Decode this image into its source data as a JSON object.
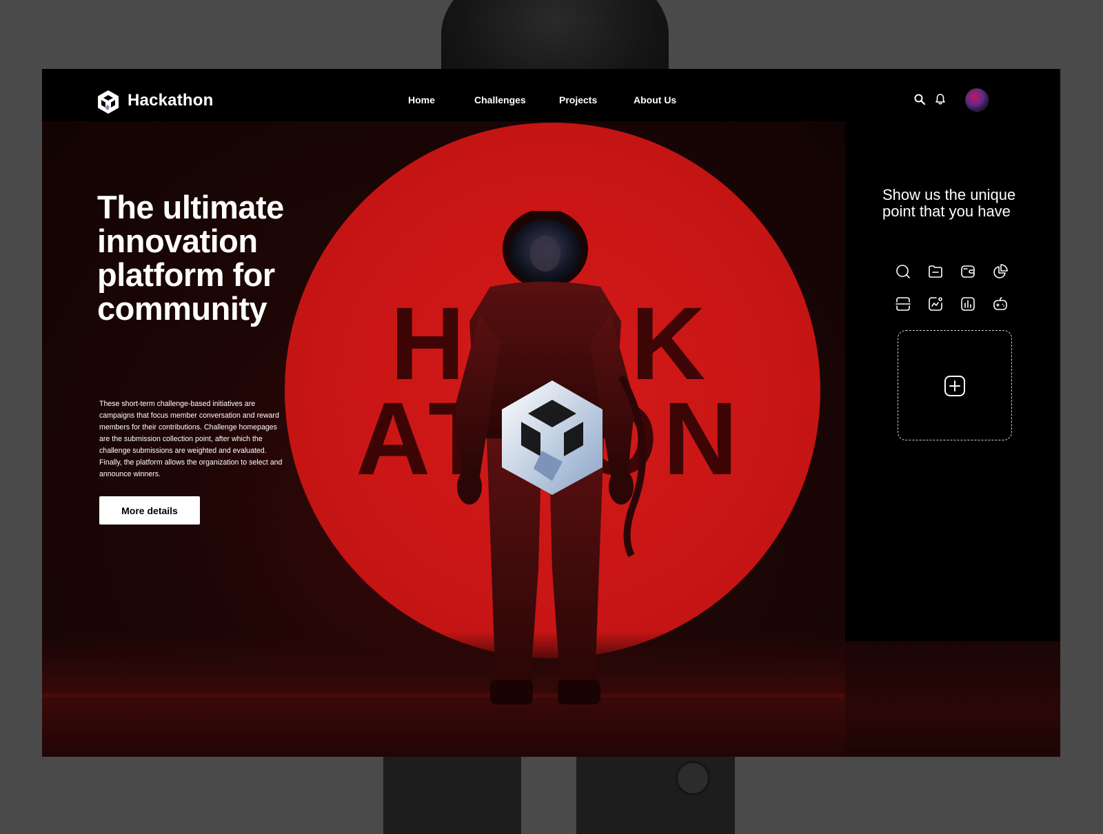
{
  "brand": {
    "name": "Hackathon",
    "logo_icon": "hackathon-cube-logo"
  },
  "nav": {
    "links": [
      "Home",
      "Challenges",
      "Projects",
      "About Us"
    ],
    "icons": [
      "search-icon",
      "bell-icon"
    ],
    "avatar": "user-avatar"
  },
  "hero": {
    "headline": "The ultimate innovation platform for community",
    "description": "These short-term challenge-based initiatives are campaigns that focus member conversation and reward members for their contributions. Challenge homepages are the submission collection point, after which the challenge submissions are weighted and evaluated. Finally, the platform allows the organization to select and announce winners.",
    "cta_label": "More details",
    "backdrop_word_line1": "HACK",
    "backdrop_word_line2": "ATHON",
    "accent_color": "#c81515"
  },
  "panel": {
    "title": "Show us the unique point that you have",
    "icons": [
      "search-icon",
      "folder-icon",
      "wallet-icon",
      "pie-chart-icon",
      "scan-icon",
      "trend-chart-icon",
      "bar-chart-icon",
      "gamepad-icon"
    ],
    "upload_icon": "add-square-icon"
  }
}
